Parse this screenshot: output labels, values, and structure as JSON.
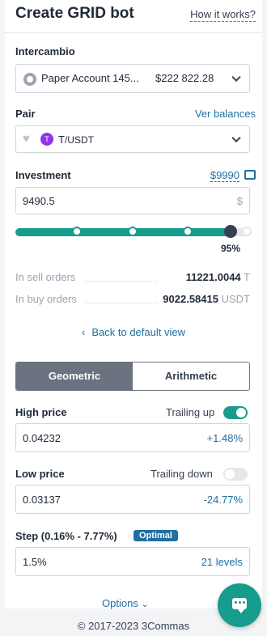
{
  "header": {
    "title": "Create GRID bot",
    "help_link": "How it works?"
  },
  "exchange": {
    "label": "Intercambio",
    "account": "Paper Account 145...",
    "balance": "$222 822.28"
  },
  "pair": {
    "label": "Pair",
    "balances_link": "Ver balances",
    "base": "T",
    "quote": "/USDT",
    "coin_glyph": "T"
  },
  "investment": {
    "label": "Investment",
    "available": "$9990",
    "value": "9490.5",
    "currency_symbol": "$",
    "slider_percent": 95,
    "slider_label": "95%"
  },
  "orders": [
    {
      "label": "In sell orders",
      "value": "11221.0044",
      "unit": "T"
    },
    {
      "label": "In buy orders",
      "value": "9022.58415",
      "unit": "USDT"
    }
  ],
  "back_link": "Back to default view",
  "mode": {
    "options": [
      "Geometric",
      "Arithmetic"
    ],
    "selected": "Geometric"
  },
  "high_price": {
    "label": "High price",
    "toggle_label": "Trailing up",
    "toggle_on": true,
    "value": "0.04232",
    "change": "+1.48%"
  },
  "low_price": {
    "label": "Low price",
    "toggle_label": "Trailing down",
    "toggle_on": false,
    "value": "0.03137",
    "change": "-24.77%"
  },
  "step": {
    "label": "Step (0.16% - 7.77%)",
    "badge": "Optimal",
    "value": "1.5%",
    "levels": "21 levels"
  },
  "options_link": "Options",
  "footer": "© 2017-2023 3Commas",
  "colors": {
    "accent": "#179c8d",
    "link": "#1f6fa3",
    "segment_active": "#6b7280"
  }
}
